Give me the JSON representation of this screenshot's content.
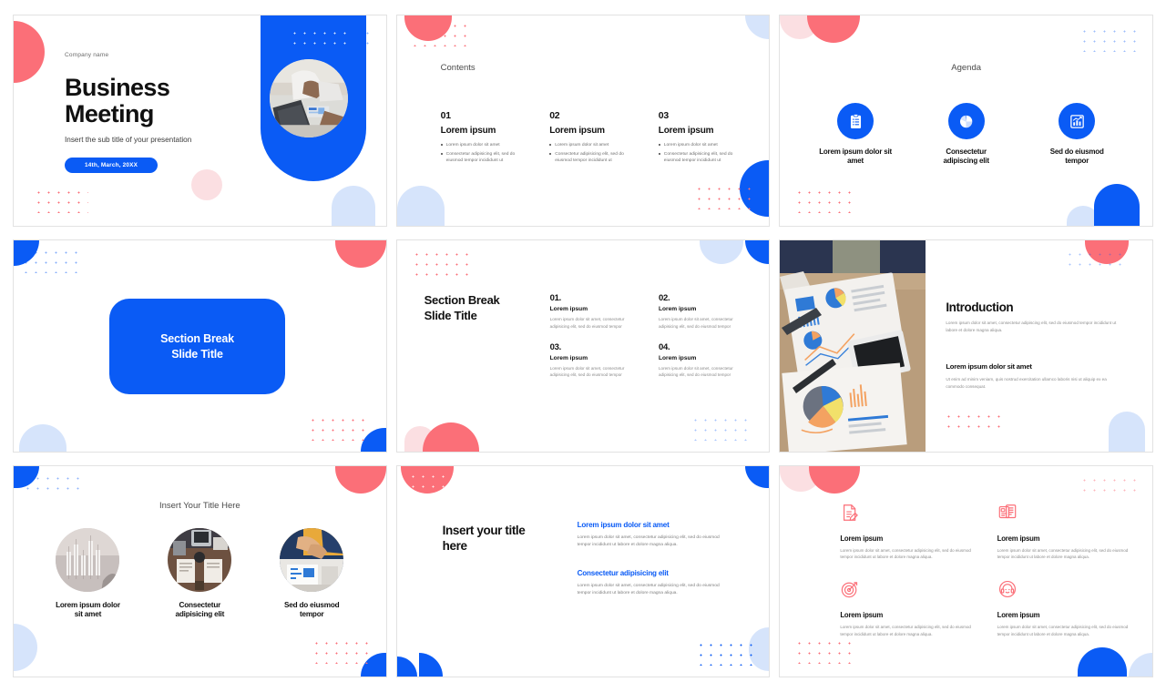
{
  "theme": {
    "blue": "#0a5bf5",
    "red": "#fb6f78",
    "light_blue": "#d6e4fb",
    "light_pink": "#fbdfe2",
    "text_dark": "#111111",
    "text_muted": "#8c8c8c"
  },
  "slides": [
    {
      "id": "title-slide",
      "company": "Company name",
      "title_line1": "Business",
      "title_line2": "Meeting",
      "subtitle": "Insert the sub title of your presentation",
      "date_pill": "14th, March, 20XX"
    },
    {
      "id": "contents-slide",
      "heading": "Contents",
      "columns": [
        {
          "number": "01",
          "title": "Lorem ipsum",
          "bullets": [
            "Lorem ipsum dolor sit amet",
            "Consectetur adipisicing elit, sed do eiusmod tempor incididunt ut"
          ]
        },
        {
          "number": "02",
          "title": "Lorem ipsum",
          "bullets": [
            "Lorem ipsum dolor sit amet",
            "Consectetur adipisicing elit, sed do eiusmod tempor incididunt ut"
          ]
        },
        {
          "number": "03",
          "title": "Lorem ipsum",
          "bullets": [
            "Lorem ipsum dolor sit amet",
            "Consectetur adipisicing elit, sed do eiusmod tempor incididunt ut"
          ]
        }
      ]
    },
    {
      "id": "agenda-slide",
      "heading": "Agenda",
      "items": [
        {
          "icon": "clipboard-checklist-icon",
          "label": "Lorem ipsum dolor sit amet"
        },
        {
          "icon": "pie-chart-icon",
          "label": "Consectetur adipiscing elit"
        },
        {
          "icon": "bar-chart-growth-icon",
          "label": "Sed do eiusmod tempor"
        }
      ]
    },
    {
      "id": "section-break-card-slide",
      "card_line1": "Section Break",
      "card_line2": "Slide Title"
    },
    {
      "id": "section-break-list-slide",
      "title_line1": "Section Break",
      "title_line2": "Slide Title",
      "items": [
        {
          "number": "01.",
          "title": "Lorem ipsum",
          "body": "Lorem ipsum dolor sit amet, consectetur adipisicing elit, sed do eiusmod tempor"
        },
        {
          "number": "02.",
          "title": "Lorem ipsum",
          "body": "Lorem ipsum dolor sit amet, consectetur adipisicing elit, sed do eiusmod tempor"
        },
        {
          "number": "03.",
          "title": "Lorem ipsum",
          "body": "Lorem ipsum dolor sit amet, consectetur adipisicing elit, sed do eiusmod tempor"
        },
        {
          "number": "04.",
          "title": "Lorem ipsum",
          "body": "Lorem ipsum dolor sit amet, consectetur adipisicing elit, sed do eiusmod tempor"
        }
      ]
    },
    {
      "id": "introduction-slide",
      "title": "Introduction",
      "body": "Lorem ipsum dolor sit amet, consectetur adipiscing elit, sed do eiusmod tempor incididunt ut labore et dolore magna aliqua.",
      "sub_title": "Lorem ipsum dolor sit amet",
      "sub_body": "Ut enim ad minim veniam, quis nostrud exercitation ullamco laboris nisi ut aliquip ex ea commodo consequat.",
      "photo_alt": "business-team-reviewing-charts-photo"
    },
    {
      "id": "three-photo-slide",
      "heading": "Insert Your Title Here",
      "items": [
        {
          "photo": "stock-chart-photo",
          "label": "Lorem ipsum dolor sit amet"
        },
        {
          "photo": "desk-meeting-photo",
          "label": "Consectetur adipisicing elit"
        },
        {
          "photo": "handshake-photo",
          "label": "Sed do eiusmod tempor"
        }
      ]
    },
    {
      "id": "two-block-text-slide",
      "title_line1": "Insert your title",
      "title_line2": "here",
      "blocks": [
        {
          "heading": "Lorem ipsum dolor sit amet",
          "body": "Lorem ipsum dolor sit amet, consectetur adipisicing elit, sed do eiusmod tempor incididunt ut labore et dolore magna aliqua."
        },
        {
          "heading": "Consectetur adipisicing elit",
          "body": "Lorem ipsum dolor sit amet, consectetur adipisicing elit, sed do eiusmod tempor incididunt ut labore et dolore magna aliqua."
        }
      ]
    },
    {
      "id": "four-feature-slide",
      "items": [
        {
          "icon": "document-pen-icon",
          "title": "Lorem ipsum",
          "body": "Lorem ipsum dolor sit amet, consectetur adipisicing elit, sed do eiusmod tempor incididunt ut labore et dolore magna aliqua."
        },
        {
          "icon": "documents-cards-icon",
          "title": "Lorem ipsum",
          "body": "Lorem ipsum dolor sit amet, consectetur adipisicing elit, sed do eiusmod tempor incididunt ut labore et dolore magna aliqua."
        },
        {
          "icon": "target-arrow-icon",
          "title": "Lorem ipsum",
          "body": "Lorem ipsum dolor sit amet, consectetur adipisicing elit, sed do eiusmod tempor incididunt ut labore et dolore magna aliqua."
        },
        {
          "icon": "headset-support-icon",
          "title": "Lorem ipsum",
          "body": "Lorem ipsum dolor sit amet, consectetur adipisicing elit, sed do eiusmod tempor incididunt ut labore et dolore magna aliqua."
        }
      ]
    }
  ]
}
